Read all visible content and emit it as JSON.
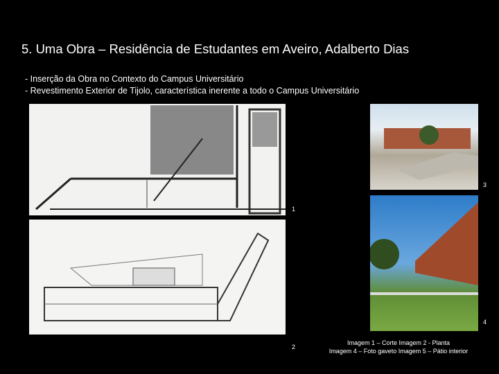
{
  "slide": {
    "title": "5. Uma Obra – Residência de Estudantes em Aveiro, Adalberto Dias",
    "bullets": [
      "- Inserção da Obra no Contexto do Campus Universitário",
      "- Revestimento Exterior de Tijolo, característica inerente a todo o Campus Universitário"
    ],
    "image_numbers": [
      "1",
      "2",
      "3",
      "4"
    ],
    "caption": [
      "Imagem 1 – Corte Imagem 2 - Planta",
      "Imagem 4 – Foto gaveto Imagem 5 – Pátio interior"
    ]
  }
}
